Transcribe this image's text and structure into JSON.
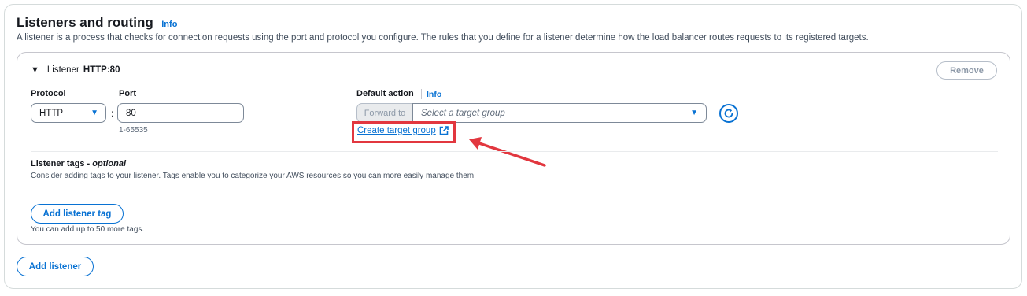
{
  "section": {
    "title": "Listeners and routing",
    "info": "Info",
    "description": "A listener is a process that checks for connection requests using the port and protocol you configure. The rules that you define for a listener determine how the load balancer routes requests to its registered targets."
  },
  "listener": {
    "label": "Listener",
    "value": "HTTP:80",
    "remove_label": "Remove",
    "protocol": {
      "label": "Protocol",
      "value": "HTTP"
    },
    "port": {
      "label": "Port",
      "value": "80",
      "hint": "1-65535"
    },
    "default_action": {
      "label": "Default action",
      "info": "Info",
      "forward_to": "Forward to",
      "placeholder": "Select a target group",
      "create_link": "Create target group"
    },
    "tags": {
      "title": "Listener tags - ",
      "title_optional": "optional",
      "description": "Consider adding tags to your listener. Tags enable you to categorize your AWS resources so you can more easily manage them.",
      "add_label": "Add listener tag",
      "limit_text": "You can add up to 50 more tags."
    }
  },
  "add_listener_label": "Add listener",
  "colors": {
    "link": "#0972d3",
    "highlight": "#e2373f",
    "text": "#16191f"
  }
}
